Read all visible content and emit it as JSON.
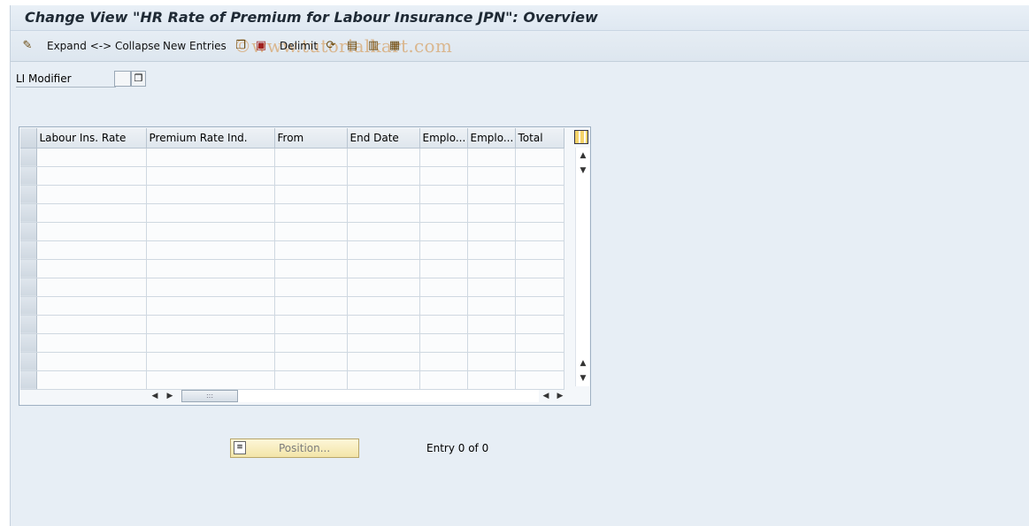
{
  "title": "Change View \"HR Rate of Premium for Labour Insurance JPN\": Overview",
  "toolbar": {
    "expand_collapse": "Expand <-> Collapse",
    "new_entries": "New Entries",
    "delimit": "Delimit",
    "watermark": "©www.tutorialkart.com"
  },
  "field": {
    "label": "LI Modifier",
    "value": ""
  },
  "table": {
    "columns": [
      "Labour Ins. Rate",
      "Premium Rate Ind.",
      "From",
      "End Date",
      "Emplo...",
      "Emplo...",
      "Total"
    ],
    "rows": [
      [],
      [],
      [],
      [],
      [],
      [],
      [],
      [],
      [],
      [],
      [],
      [],
      []
    ]
  },
  "footer": {
    "position_label": "Position...",
    "entry_text": "Entry 0 of 0"
  },
  "colors": {
    "background": "#e7eef5",
    "button": "#f3e5a8"
  },
  "icons": [
    "display-change-icon",
    "copy-icon",
    "save-icon",
    "delimit-icon",
    "select-all-icon",
    "select-block-icon",
    "deselect-all-icon",
    "table-settings-icon"
  ]
}
